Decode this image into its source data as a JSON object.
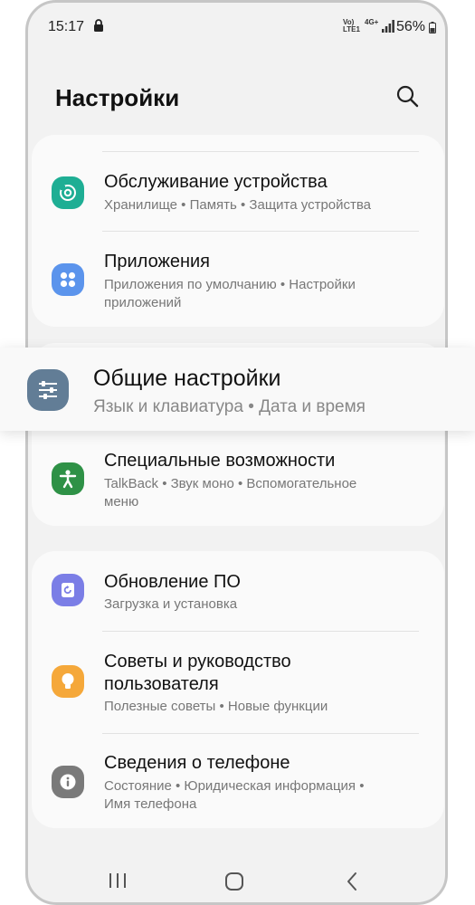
{
  "status_bar": {
    "time": "15:17",
    "volte_label": "Vo) LTE1",
    "network_label": "4G+",
    "battery_percent": "56%"
  },
  "header": {
    "title": "Настройки"
  },
  "items": [
    {
      "title": "Обслуживание устройства",
      "subtitle": "Хранилище • Память • Защита устройства",
      "icon": "device-care-icon",
      "color": "#1eae94"
    },
    {
      "title": "Приложения",
      "subtitle": "Приложения по умолчанию • Настройки",
      "subtitle2": "приложений",
      "icon": "apps-icon",
      "color": "#5b94ec"
    },
    {
      "title": "Общие настройки",
      "subtitle": "Язык и клавиатура • Дата и время",
      "icon": "general-settings-icon",
      "color": "#627d96"
    },
    {
      "title": "Специальные возможности",
      "subtitle": "TalkBack • Звук моно • Вспомогательное",
      "subtitle2": "меню",
      "icon": "accessibility-icon",
      "color": "#2e9146"
    },
    {
      "title": "Обновление ПО",
      "subtitle": "Загрузка и установка",
      "icon": "software-update-icon",
      "color": "#7b7ee6"
    },
    {
      "title": "Советы и руководство",
      "title2": "пользователя",
      "subtitle": "Полезные советы • Новые функции",
      "icon": "tips-icon",
      "color": "#f5a83a"
    },
    {
      "title": "Сведения о телефоне",
      "subtitle": "Состояние • Юридическая информация •",
      "subtitle2": "Имя телефона",
      "icon": "about-phone-icon",
      "color": "#7a7a7a"
    }
  ]
}
